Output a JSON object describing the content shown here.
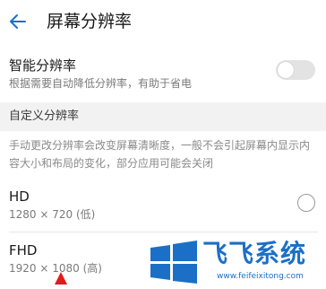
{
  "header": {
    "title": "屏幕分辨率",
    "back_icon": "arrow-left-icon"
  },
  "smart_resolution": {
    "title": "智能分辨率",
    "subtitle": "根据需要自动降低分辨率，有助于省电",
    "enabled": false
  },
  "custom_section": {
    "title": "自定义分辨率",
    "description": "手动更改分辨率会改变屏幕清晰度，一般不会引起屏幕内显示内容大小和布局的变化，部分应用可能会关闭"
  },
  "options": [
    {
      "name": "HD",
      "detail": "1280 × 720 (低)",
      "selected": false
    },
    {
      "name": "FHD",
      "detail": "1920 × 1080 (高)",
      "selected": false
    }
  ],
  "watermark": {
    "text": "飞飞系统",
    "url": "www.feifeixitong.com"
  },
  "colors": {
    "accent": "#1c6fc6",
    "section_band": "#f2f2f2",
    "toggle_off": "#e3e3e3",
    "annotation_arrow": "#e01b1b"
  }
}
